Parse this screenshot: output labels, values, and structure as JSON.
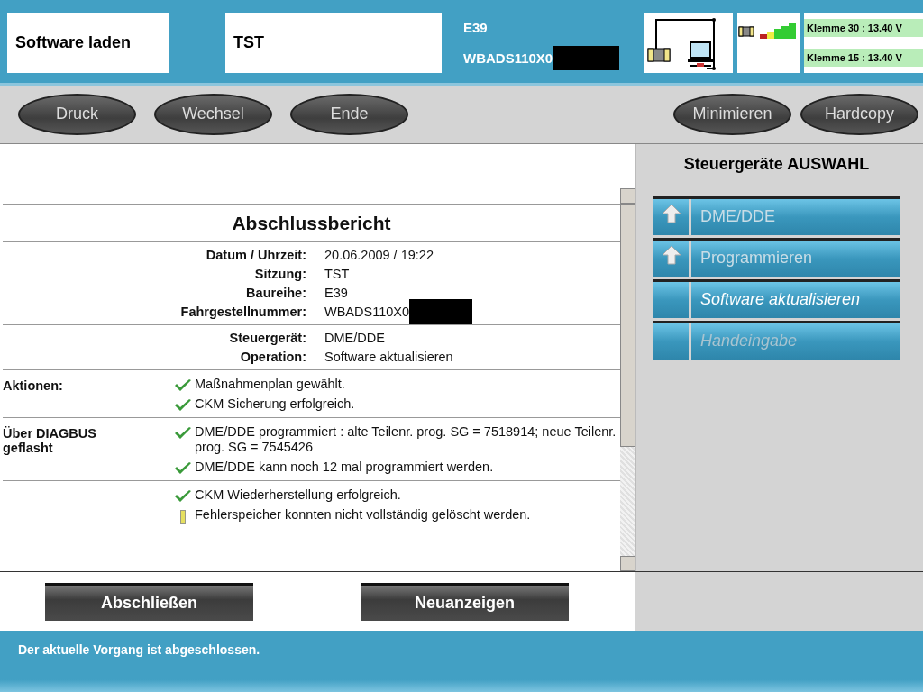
{
  "header": {
    "function": "Software laden",
    "session": "TST",
    "series": "E39",
    "vin": {
      "text": "WBADS110X0",
      "redacted": true
    },
    "voltages": [
      "Klemme 30 : 13.40 V",
      "Klemme 15 : 13.40 V"
    ]
  },
  "toolbar": {
    "left": [
      "Druck",
      "Wechsel",
      "Ende"
    ],
    "right": [
      "Minimieren",
      "Hardcopy"
    ]
  },
  "report": {
    "title": "Abschlussbericht",
    "field_groups": [
      [
        {
          "label": "Datum / Uhrzeit:",
          "value": "20.06.2009 / 19:22",
          "redacted": false
        },
        {
          "label": "Sitzung:",
          "value": "TST",
          "redacted": false
        },
        {
          "label": "Baureihe:",
          "value": "E39",
          "redacted": false
        },
        {
          "label": "Fahrgestellnummer:",
          "value": "WBADS110X0",
          "redacted": true
        }
      ],
      [
        {
          "label": "Steuergerät:",
          "value": "DME/DDE",
          "redacted": false
        },
        {
          "label": "Operation:",
          "value": "Software aktualisieren",
          "redacted": false
        }
      ]
    ],
    "sections": [
      {
        "heading": "Aktionen:",
        "items": [
          {
            "kind": "ok",
            "text": "Maßnahmenplan gewählt."
          },
          {
            "kind": "ok",
            "text": "CKM Sicherung erfolgreich."
          }
        ]
      },
      {
        "heading": "Über DIAGBUS geflasht",
        "items": [
          {
            "kind": "ok",
            "text": "DME/DDE programmiert : alte Teilenr. prog. SG = 7518914; neue Teilenr. prog. SG = 7545426"
          },
          {
            "kind": "ok",
            "text": "DME/DDE kann noch 12 mal programmiert werden."
          }
        ]
      },
      {
        "items": [
          {
            "kind": "ok",
            "text": "CKM Wiederherstellung erfolgreich."
          },
          {
            "kind": "warning",
            "text": "Fehlerspeicher konnten nicht vollständig gelöscht werden."
          }
        ]
      }
    ]
  },
  "sidebar": {
    "title": "Steuergeräte AUSWAHL",
    "items": [
      {
        "label": "DME/DDE",
        "kind": "level-up",
        "selected": false,
        "disabled": false
      },
      {
        "label": "Programmieren",
        "kind": "level-up",
        "selected": false,
        "disabled": false
      },
      {
        "label": "Software aktualisieren",
        "kind": "plain",
        "selected": true,
        "disabled": false
      },
      {
        "label": "Handeingabe",
        "kind": "plain",
        "selected": false,
        "disabled": true
      }
    ]
  },
  "actions": [
    "Abschließen",
    "Neuanzeigen"
  ],
  "status_bar": "Der aktuelle Vorgang ist abgeschlossen."
}
